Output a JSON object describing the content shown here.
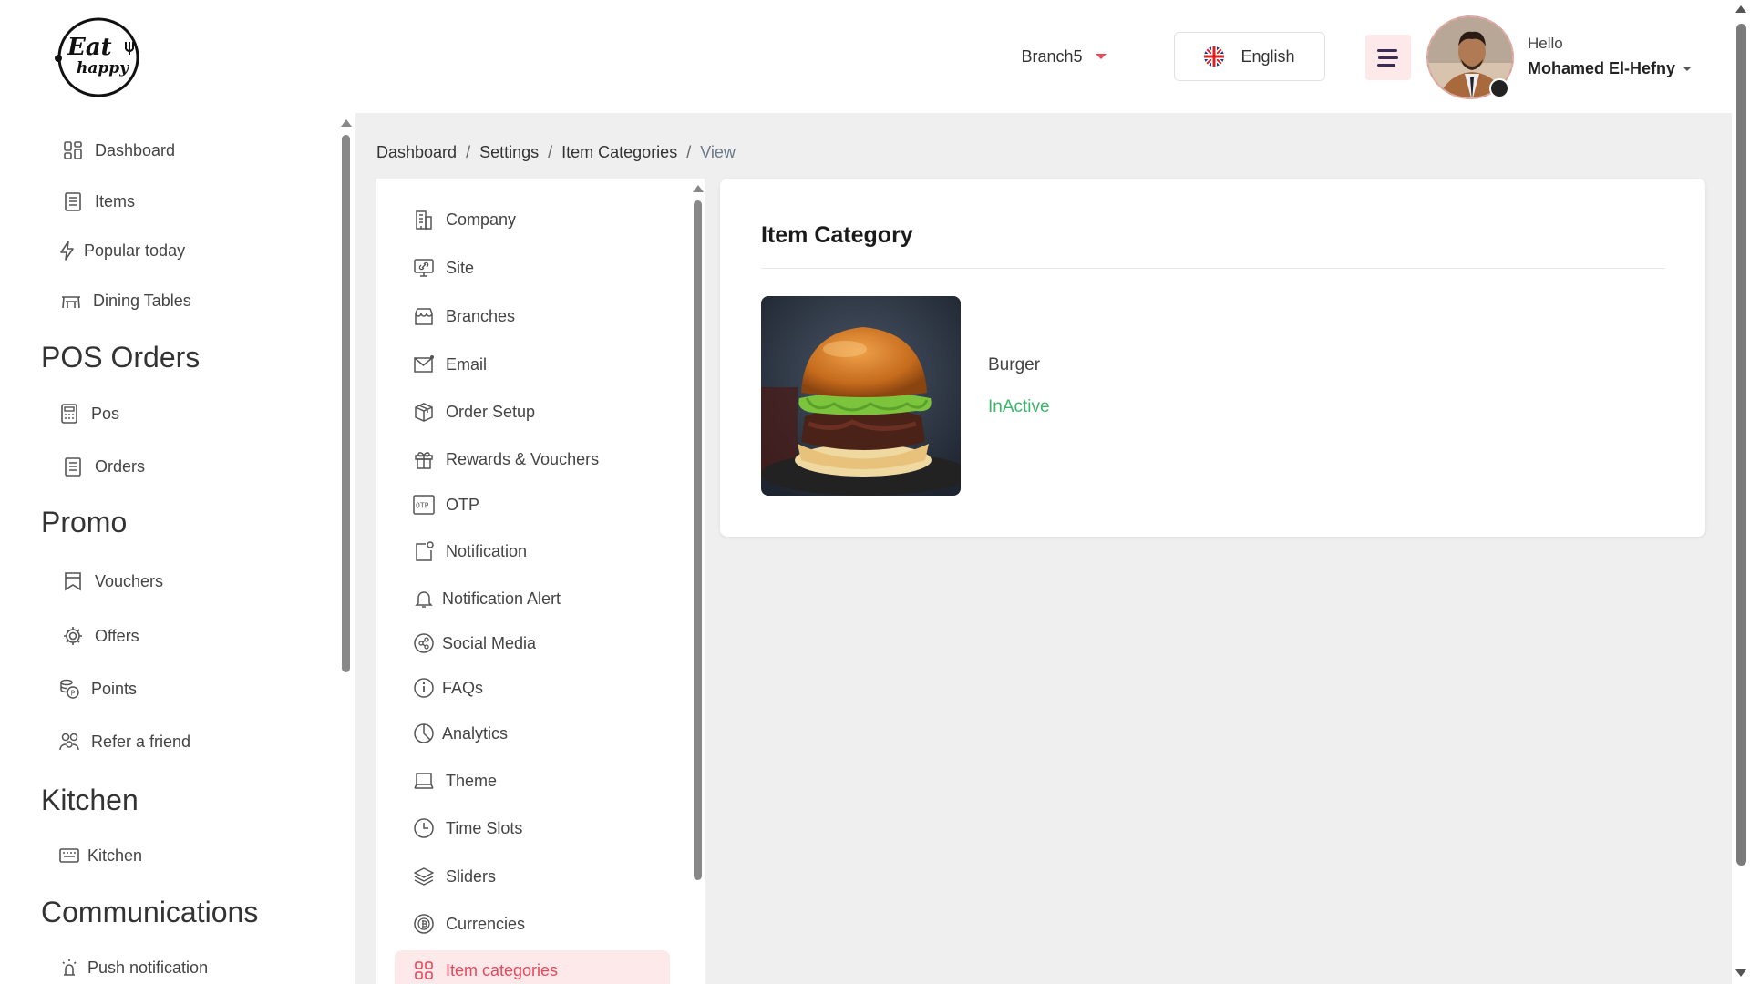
{
  "header": {
    "logo_text_1": "Eat",
    "logo_text_2": "happy",
    "branch": "Branch5",
    "language": "English",
    "greeting": "Hello",
    "user_name": "Mohamed El-Hefny"
  },
  "sidebar": {
    "items_top": [
      {
        "label": "Dashboard",
        "icon": "dashboard-icon"
      },
      {
        "label": "Items",
        "icon": "items-icon"
      },
      {
        "label": "Popular today",
        "icon": "bolt-icon"
      },
      {
        "label": "Dining Tables",
        "icon": "table-icon"
      }
    ],
    "sections": [
      {
        "title": "POS Orders",
        "items": [
          {
            "label": "Pos",
            "icon": "pos-icon"
          },
          {
            "label": "Orders",
            "icon": "orders-icon"
          }
        ]
      },
      {
        "title": "Promo",
        "items": [
          {
            "label": "Vouchers",
            "icon": "voucher-icon"
          },
          {
            "label": "Offers",
            "icon": "gear-icon"
          },
          {
            "label": "Points",
            "icon": "coins-icon"
          },
          {
            "label": "Refer a friend",
            "icon": "users-icon"
          }
        ]
      },
      {
        "title": "Kitchen",
        "items": [
          {
            "label": "Kitchen",
            "icon": "kitchen-icon"
          }
        ]
      },
      {
        "title": "Communications",
        "items": [
          {
            "label": "Push notification",
            "icon": "alarm-icon"
          }
        ]
      }
    ]
  },
  "breadcrumb": {
    "items": [
      "Dashboard",
      "Settings",
      "Item Categories"
    ],
    "current": "View",
    "separator": "/"
  },
  "settings_menu": {
    "items": [
      "Company",
      "Site",
      "Branches",
      "Email",
      "Order Setup",
      "Rewards & Vouchers",
      "OTP",
      "Notification",
      "Notification Alert",
      "Social Media",
      "FAQs",
      "Analytics",
      "Theme",
      "Time Slots",
      "Sliders",
      "Currencies",
      "Item categories"
    ],
    "active": "Item categories",
    "otp_glyph": "OTP"
  },
  "card": {
    "title": "Item Category",
    "name": "Burger",
    "status": "InActive"
  },
  "colors": {
    "accent": "#e9475b",
    "active_bg": "#fde8ea",
    "status_green": "#3cb56b",
    "content_bg": "#efefef"
  }
}
